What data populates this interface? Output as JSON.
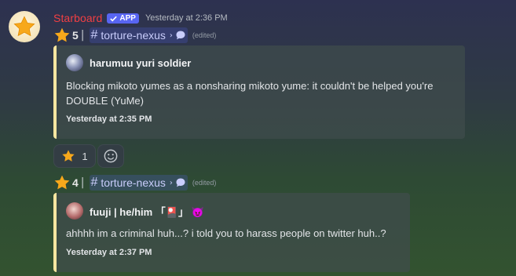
{
  "message": {
    "username": "Starboard",
    "app_badge": "APP",
    "timestamp": "Yesterday at 2:36 PM"
  },
  "posts": [
    {
      "star_count": "5",
      "channel": "torture-nexus",
      "edited": "(edited)",
      "embed": {
        "author": "harumuu yuri soldier",
        "text": "Blocking mikoto yumes as a nonsharing mikoto yume: it couldn't be helped you're DOUBLE (YuMe)",
        "footer": "Yesterday at 2:35 PM"
      },
      "reaction_count": "1"
    },
    {
      "star_count": "4",
      "channel": "torture-nexus",
      "edited": "(edited)",
      "embed": {
        "author": "fuuji | he/him 「🎴」 😈",
        "text": "ahhhh im a criminal huh...? i told you to harass people on twitter huh..?",
        "footer": "Yesterday at 2:37 PM"
      }
    }
  ],
  "colors": {
    "username": "#f23f43",
    "app_badge": "#5865f2",
    "embed_bar": "#f7e6a0",
    "channel": "#c9cdfb"
  },
  "icons": [
    "star-icon",
    "checkmark-icon",
    "chat-bubble-icon",
    "add-reaction-icon",
    "chevron-right-icon"
  ]
}
